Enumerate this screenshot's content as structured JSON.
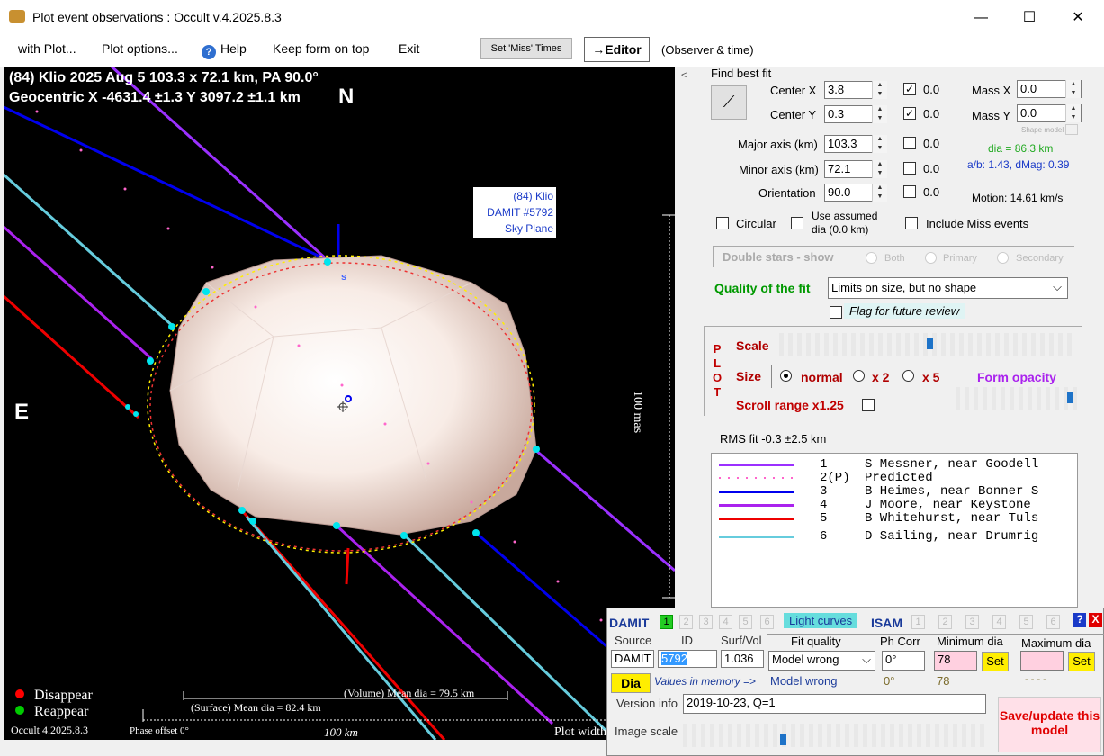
{
  "window": {
    "title": "Plot event observations : Occult v.4.2025.8.3",
    "min": "—",
    "max": "☐",
    "close": "✕"
  },
  "menu": {
    "with_plot": "with Plot...",
    "plot_options": "Plot options...",
    "help": "Help",
    "keep_on_top": "Keep form on top",
    "exit": "Exit",
    "set_miss": "Set 'Miss' Times",
    "editor": "→Editor",
    "observer_time": "(Observer & time)"
  },
  "plot": {
    "line1": "(84) Klio  2025 Aug 5   103.3 x 72.1 km, PA 90.0°",
    "line2": "Geocentric  X  -4631.4 ±1.3  Y 3097.2 ±1.1 km",
    "north": "N",
    "east": "E",
    "south": "s",
    "model_label": [
      "(84) Klio",
      "DAMIT #5792",
      "Sky Plane"
    ],
    "scale_mas": "100 mas",
    "disappear": "Disappear",
    "reappear": "Reappear",
    "version": "Occult 4.2025.8.3",
    "phase": "Phase offset 0°",
    "km_scale": "100 km",
    "volume_dia": "(Volume) Mean dia = 79.5 km",
    "surface_dia": "(Surface) Mean dia = 82.4 km",
    "plot_width": "Plot width"
  },
  "fit": {
    "find_best": "Find best fit",
    "center_x_label": "Center X",
    "center_x": "3.8",
    "center_x_chk": "0.0",
    "center_y_label": "Center Y",
    "center_y": "0.3",
    "center_y_chk": "0.0",
    "major_label": "Major axis (km)",
    "major": "103.3",
    "major_chk": "0.0",
    "minor_label": "Minor axis (km)",
    "minor": "72.1",
    "minor_chk": "0.0",
    "orient_label": "Orientation",
    "orient": "90.0",
    "orient_chk": "0.0",
    "massx_label": "Mass X",
    "massx": "0.0",
    "massy_label": "Mass Y",
    "massy": "0.0",
    "shape_model": "Shape model",
    "dia": "dia = 86.3 km",
    "ab": "a/b: 1.43, dMag: 0.39",
    "motion": "Motion: 14.61 km/s",
    "circular": "Circular",
    "use_assumed": "Use assumed",
    "assumed_dia": "dia (0.0 km)",
    "include_miss": "Include Miss events",
    "double_stars": "Double stars - show",
    "both": "Both",
    "primary": "Primary",
    "secondary": "Secondary",
    "quality_label": "Quality of the fit",
    "quality": "Limits on size, but no shape",
    "flag": "Flag for future review"
  },
  "plotctl": {
    "plot_vertical": [
      "P",
      "L",
      "O",
      "T"
    ],
    "scale": "Scale",
    "size": "Size",
    "normal": "normal",
    "x2": "x 2",
    "x5": "x 5",
    "form_opacity": "Form opacity",
    "scroll": "Scroll range x1.25"
  },
  "rms": "RMS fit -0.3 ±2.5 km",
  "legend": [
    {
      "num": "1",
      "text": "S Messner, near Goodell",
      "color": "#9b30ff"
    },
    {
      "num": "2(P)",
      "text": "Predicted",
      "color": "#ff66cc"
    },
    {
      "num": "3",
      "text": "B Heimes, near Bonner S",
      "color": "#0000ee"
    },
    {
      "num": "4",
      "text": "J Moore, near Keystone",
      "color": "#aa22ee"
    },
    {
      "num": "5",
      "text": "B Whitehurst, near Tuls",
      "color": "#ee0000"
    },
    {
      "num": "6",
      "text": "D Sailing, near Drumrig",
      "color": "#66ccdd"
    }
  ],
  "damit": {
    "damit": "DAMIT",
    "tabs": [
      "1",
      "2",
      "3",
      "4",
      "5",
      "6"
    ],
    "light_curves": "Light curves",
    "isam": "ISAM",
    "isam_tabs": [
      "1",
      "2",
      "3",
      "4",
      "5",
      "6"
    ],
    "help": "?",
    "close": "X",
    "source_label": "Source",
    "id_label": "ID",
    "surfvol_label": "Surf/Vol",
    "source": "DAMIT",
    "id": "5792",
    "surfvol": "1.036",
    "dia_btn": "Dia",
    "values_mem": "Values in memory =>",
    "fit_quality_label": "Fit quality",
    "fit_quality": "Model wrong",
    "fit_quality_mem": "Model wrong",
    "phcorr_label": "Ph Corr",
    "phcorr": "0°",
    "phcorr_mem": "0°",
    "mindia_label": "Minimum dia",
    "mindia": "78",
    "mindia_mem": "78",
    "set1": "Set",
    "maxdia_label": "Maximum dia",
    "maxdia": "",
    "maxdia_mem": "- - - -",
    "set2": "Set",
    "version_label": "Version info",
    "version": "2019-10-23, Q=1",
    "image_scale": "Image scale",
    "save": "Save/update this model"
  },
  "colors": {
    "disappear": "#ff0000",
    "reappear": "#00cc00",
    "quality_green": "#009900",
    "plot_label_red": "#b00000",
    "damit_blue": "#1a3a9a",
    "save_bg": "#ffe0e8",
    "save_red": "#e00000"
  }
}
